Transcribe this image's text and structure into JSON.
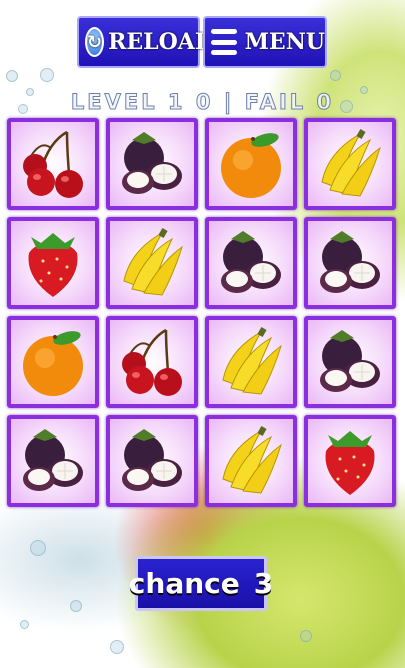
{
  "toolbar": {
    "reload_label": "RELOAD",
    "menu_label": "MENU"
  },
  "status": {
    "level_label": "LEVEL",
    "level_value": "1 0",
    "fail_label": "FAIL",
    "fail_value": "0",
    "separator": "|"
  },
  "board": {
    "cards": [
      {
        "fruit": "cherry"
      },
      {
        "fruit": "mangosteen"
      },
      {
        "fruit": "orange"
      },
      {
        "fruit": "banana"
      },
      {
        "fruit": "strawberry"
      },
      {
        "fruit": "banana"
      },
      {
        "fruit": "mangosteen"
      },
      {
        "fruit": "mangosteen"
      },
      {
        "fruit": "orange"
      },
      {
        "fruit": "cherry"
      },
      {
        "fruit": "banana"
      },
      {
        "fruit": "mangosteen"
      },
      {
        "fruit": "mangosteen"
      },
      {
        "fruit": "mangosteen"
      },
      {
        "fruit": "banana"
      },
      {
        "fruit": "strawberry"
      }
    ]
  },
  "chance": {
    "label": "chance",
    "value": "3"
  },
  "colors": {
    "button_blue": "#2419c4",
    "card_border": "#8a2fe0",
    "card_glow": "#eab8f6"
  }
}
